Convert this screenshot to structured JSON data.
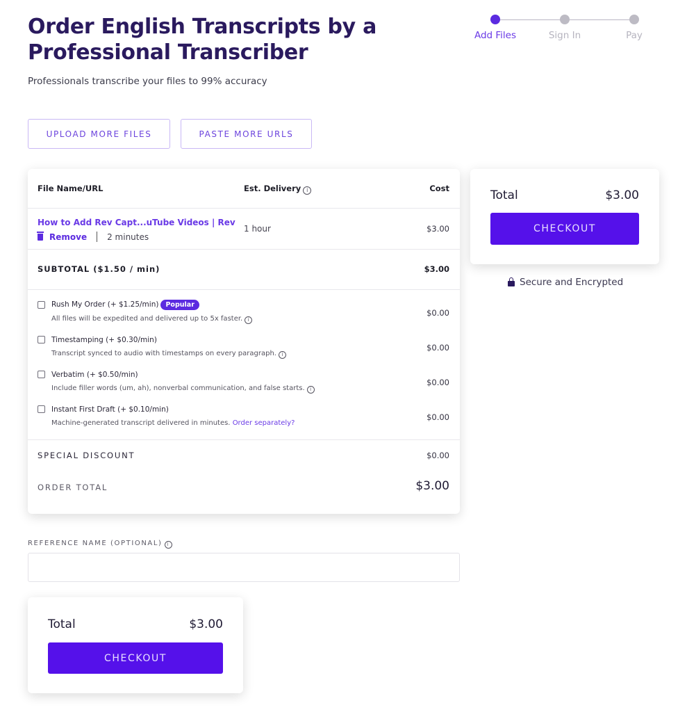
{
  "header": {
    "title": "Order English Transcripts by a Professional Transcriber",
    "subtitle": "Professionals transcribe your files to 99% accuracy"
  },
  "stepper": {
    "steps": [
      {
        "label": "Add Files",
        "active": true
      },
      {
        "label": "Sign In",
        "active": false
      },
      {
        "label": "Pay",
        "active": false
      }
    ]
  },
  "actions": {
    "upload_label": "UPLOAD MORE FILES",
    "paste_label": "PASTE MORE URLS"
  },
  "order": {
    "columns": {
      "file": "File Name/URL",
      "delivery": "Est. Delivery",
      "cost": "Cost"
    },
    "files": [
      {
        "name": "How to Add Rev Capt...uTube Videos | Rev",
        "remove_label": "Remove",
        "duration": "2 minutes",
        "delivery": "1 hour",
        "cost": "$3.00"
      }
    ],
    "subtotal_label": "SUBTOTAL ($1.50 / min)",
    "subtotal_value": "$3.00",
    "options": [
      {
        "title": "Rush My Order (+ $1.25/min)",
        "badge": "Popular",
        "desc": "All files will be expedited and delivered up to 5x faster.",
        "price": "$0.00",
        "checked": false
      },
      {
        "title": "Timestamping (+ $0.30/min)",
        "desc": "Transcript synced to audio with timestamps on every paragraph.",
        "price": "$0.00",
        "checked": false
      },
      {
        "title": "Verbatim (+ $0.50/min)",
        "desc": "Include filler words (um, ah), nonverbal communication, and false starts.",
        "price": "$0.00",
        "checked": false
      },
      {
        "title": "Instant First Draft (+ $0.10/min)",
        "desc": "Machine-generated transcript delivered in minutes.",
        "link": "Order separately?",
        "price": "$0.00",
        "checked": false
      }
    ],
    "discount_label": "SPECIAL DISCOUNT",
    "discount_value": "$0.00",
    "total_label": "ORDER TOTAL",
    "total_value": "$3.00"
  },
  "summary": {
    "total_label": "Total",
    "total_value": "$3.00",
    "checkout_label": "CHECKOUT",
    "secure_label": "Secure and Encrypted"
  },
  "reference": {
    "label": "REFERENCE NAME (OPTIONAL)",
    "value": "",
    "placeholder": ""
  },
  "icons": {
    "info": "i"
  },
  "colors": {
    "brand": "#5511ea",
    "accent": "#6a3ae6",
    "title": "#2a1a5e"
  }
}
